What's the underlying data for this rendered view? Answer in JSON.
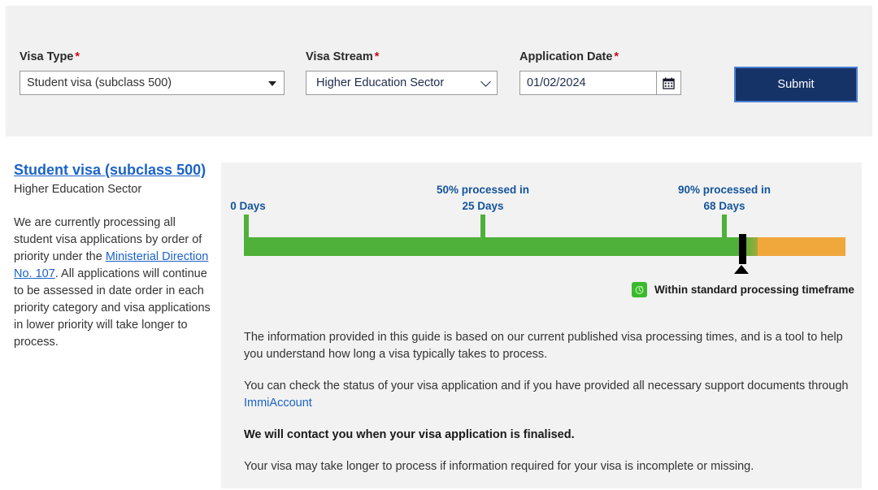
{
  "form": {
    "visa_type": {
      "label": "Visa Type",
      "required_mark": "*",
      "value": "Student visa (subclass 500)"
    },
    "visa_stream": {
      "label": "Visa Stream",
      "required_mark": "*",
      "value": "Higher Education Sector"
    },
    "application_date": {
      "label": "Application Date",
      "required_mark": "*",
      "value": "01/02/2024",
      "calendar_icon": "calendar-icon"
    },
    "submit_label": "Submit"
  },
  "sidebar": {
    "visa_title": "Student visa (subclass 500)",
    "visa_stream": "Higher Education Sector",
    "paragraph_part1": "We are currently processing all student visa applications by order of priority under the ",
    "paragraph_link": "Ministerial Direction No. 107",
    "paragraph_part2": ". All applications will continue to be assessed in date order in each priority category and visa applications in lower priority will take longer to process."
  },
  "chart_data": {
    "type": "bar",
    "title": "Visa processing timeline",
    "xlabel": "Days",
    "ylabel": "",
    "grid": false,
    "legend_position": "bottom-right",
    "axis_range_days": [
      0,
      75
    ],
    "markers": [
      {
        "name": "start",
        "label_line1": "0 Days",
        "label_line2": "",
        "days": 0
      },
      {
        "name": "p50",
        "label_line1": "50% processed in",
        "label_line2": "25 Days",
        "days": 25
      },
      {
        "name": "p90",
        "label_line1": "90% processed in",
        "label_line2": "68 Days",
        "days": 68
      }
    ],
    "current_position": {
      "name": "current-application-marker",
      "days": 70
    },
    "segments": [
      {
        "name": "within-timeframe",
        "color": "#4fb03a",
        "from_days": 0,
        "to_days": 68
      },
      {
        "name": "beyond-timeframe",
        "color": "#f0a73c",
        "from_days": 68,
        "to_days": 75
      }
    ],
    "legend": [
      {
        "label": "Within standard processing timeframe",
        "color": "#3cb82e",
        "icon": "clock-icon"
      }
    ]
  },
  "panel": {
    "para1": "The information provided in this guide is based on our current published visa processing times, and is a tool to help you understand how long a visa typically takes to process.",
    "para2_part1": "You can check the status of your visa application and if you have provided all necessary support documents through ",
    "para2_link": "ImmiAccount",
    "para3": "We will contact you when your visa application is finalised.",
    "para4": "Your visa may take longer to process if information required for your visa is incomplete or missing."
  },
  "colors": {
    "brand_navy": "#163368",
    "link_blue": "#1b63c8",
    "label_blue": "#14549c",
    "green": "#4fb03a",
    "orange": "#f0a73c",
    "required_red": "#d0021b"
  }
}
